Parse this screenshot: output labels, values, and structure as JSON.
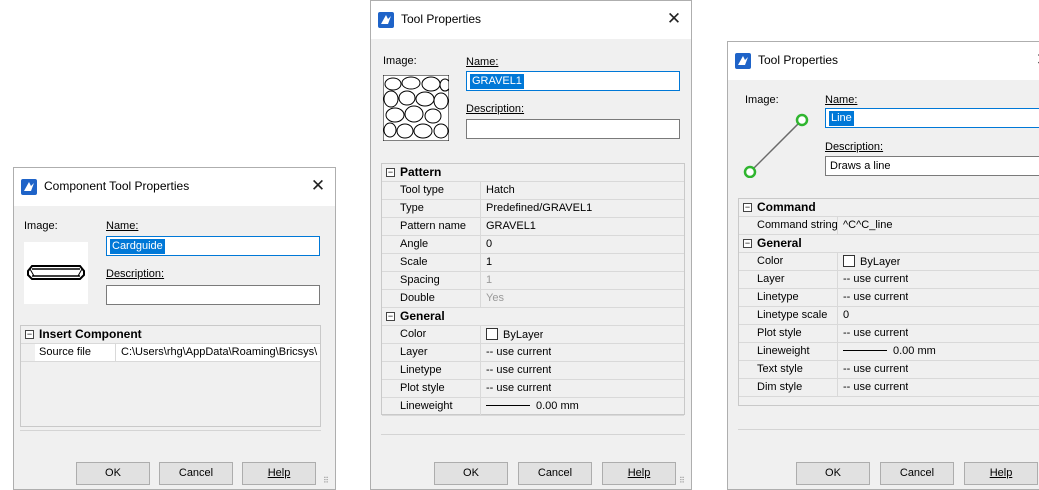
{
  "dialogs": [
    {
      "title": "Component Tool Properties",
      "image_label": "Image:",
      "name_label": "Name:",
      "name_value": "Cardguide",
      "description_label": "Description:",
      "description_value": "",
      "categories": [
        {
          "label": "Insert Component",
          "rows": [
            {
              "key": "Source file",
              "value": "C:\\Users\\rhg\\AppData\\Roaming\\Bricsys\\"
            }
          ]
        }
      ],
      "buttons": {
        "ok": "OK",
        "cancel": "Cancel",
        "help": "Help"
      }
    },
    {
      "title": "Tool Properties",
      "image_label": "Image:",
      "name_label": "Name:",
      "name_value": "GRAVEL1",
      "description_label": "Description:",
      "description_value": "",
      "categories": [
        {
          "label": "Pattern",
          "rows": [
            {
              "key": "Tool type",
              "value": "Hatch"
            },
            {
              "key": "Type",
              "value": "Predefined/GRAVEL1"
            },
            {
              "key": "Pattern name",
              "value": "GRAVEL1"
            },
            {
              "key": "Angle",
              "value": "0"
            },
            {
              "key": "Scale",
              "value": "1"
            },
            {
              "key": "Spacing",
              "value": "1",
              "dim": true
            },
            {
              "key": "Double",
              "value": "Yes",
              "dim": true
            }
          ]
        },
        {
          "label": "General",
          "rows": [
            {
              "key": "Color",
              "value": "ByLayer",
              "swatch": true
            },
            {
              "key": "Layer",
              "value": "-- use current"
            },
            {
              "key": "Linetype",
              "value": "-- use current"
            },
            {
              "key": "Plot style",
              "value": "-- use current"
            },
            {
              "key": "Lineweight",
              "value": "0.00 mm",
              "lineweight": true
            }
          ]
        }
      ],
      "buttons": {
        "ok": "OK",
        "cancel": "Cancel",
        "help": "Help"
      }
    },
    {
      "title": "Tool Properties",
      "image_label": "Image:",
      "name_label": "Name:",
      "name_value": "Line",
      "description_label": "Description:",
      "description_value": "Draws a line",
      "categories": [
        {
          "label": "Command",
          "rows": [
            {
              "key": "Command string",
              "value": "^C^C_line"
            }
          ]
        },
        {
          "label": "General",
          "rows": [
            {
              "key": "Color",
              "value": "ByLayer",
              "swatch": true
            },
            {
              "key": "Layer",
              "value": "-- use current"
            },
            {
              "key": "Linetype",
              "value": "-- use current"
            },
            {
              "key": "Linetype scale",
              "value": "0"
            },
            {
              "key": "Plot style",
              "value": "-- use current"
            },
            {
              "key": "Lineweight",
              "value": "0.00 mm",
              "lineweight": true
            },
            {
              "key": "Text style",
              "value": "-- use current"
            },
            {
              "key": "Dim style",
              "value": "-- use current"
            }
          ]
        }
      ],
      "buttons": {
        "ok": "OK",
        "cancel": "Cancel",
        "help": "Help"
      }
    }
  ],
  "icons": {
    "title": "bricscad-app-icon",
    "close": "close-icon",
    "collapse": "collapse-minus-icon",
    "grip": "resize-grip-icon"
  },
  "colors": {
    "selection": "#0078d7",
    "window_bg": "#f0f0f0",
    "line_endpoint": "#2fb52f"
  }
}
